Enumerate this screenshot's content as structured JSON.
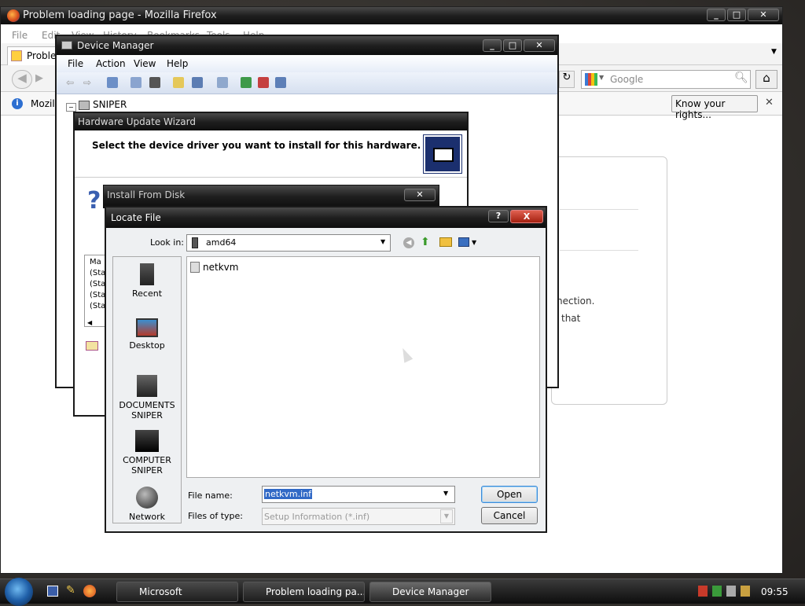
{
  "firefox": {
    "title": "Problem loading page - Mozilla Firefox",
    "menu": [
      "File",
      "Edit",
      "View",
      "History",
      "Bookmarks",
      "Tools",
      "Help"
    ],
    "tab_label": "Probler",
    "search_placeholder": "Google",
    "bookmark_label": "Mozill",
    "rights_button": "Know your rights...",
    "error_text_1": "nection.",
    "error_text_2": "that"
  },
  "device_manager": {
    "title": "Device Manager",
    "menu": [
      "File",
      "Action",
      "View",
      "Help"
    ],
    "tree_root": "SNIPER"
  },
  "wizard": {
    "title": "Hardware Update Wizard",
    "heading": "Select the device driver you want to install for this hardware.",
    "list_header": "Ma",
    "list_items": [
      "(Sta",
      "(Sta",
      "(Sta",
      "(Sta"
    ]
  },
  "install_from_disk": {
    "title": "Install From Disk"
  },
  "locate_file": {
    "title": "Locate File",
    "look_in_label": "Look in:",
    "look_in_value": "amd64",
    "places": [
      "Recent",
      "Desktop",
      "DOCUMENTS SNIPER",
      "COMPUTER SNIPER",
      "Network"
    ],
    "files": [
      "netkvm"
    ],
    "file_name_label": "File name:",
    "file_name_value": "netkvm.inf",
    "file_type_label": "Files of type:",
    "file_type_value": "Setup Information (*.inf)",
    "open_button": "Open",
    "cancel_button": "Cancel",
    "help_button": "?",
    "close_button": "X"
  },
  "taskbar": {
    "items": [
      "Microsoft",
      "Problem loading pa...",
      "Device Manager"
    ],
    "clock": "09:55"
  }
}
